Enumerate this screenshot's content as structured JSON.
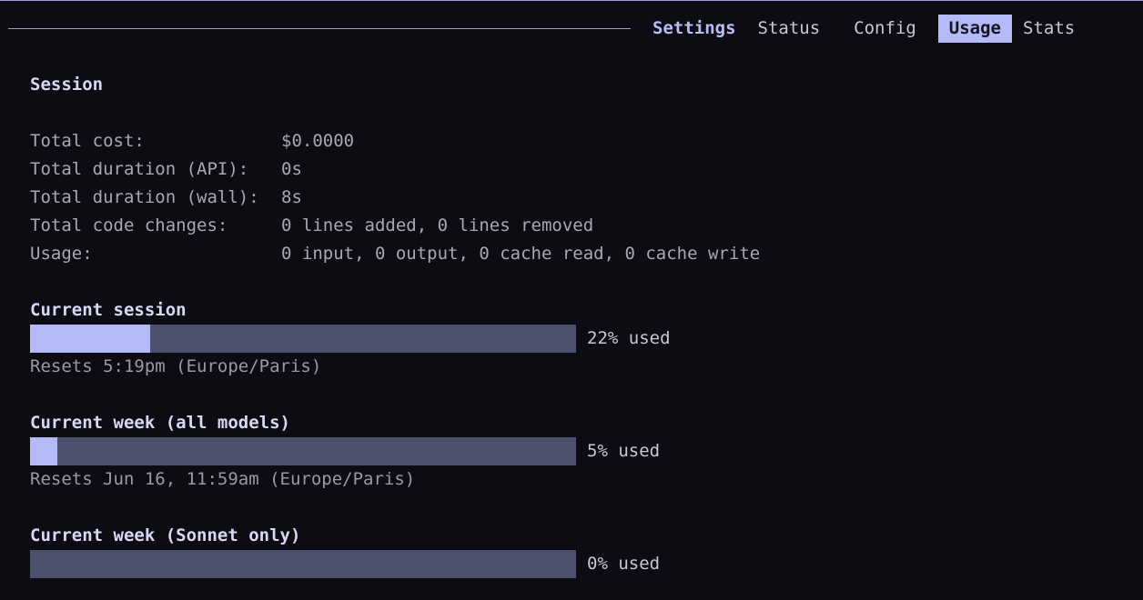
{
  "tabs": {
    "title": "Settings",
    "items": [
      "Status",
      "Config",
      "Usage",
      "Stats"
    ],
    "active": "Usage"
  },
  "session": {
    "heading": "Session",
    "stats": [
      {
        "label": "Total cost:",
        "value": "$0.0000"
      },
      {
        "label": "Total duration (API):",
        "value": "0s"
      },
      {
        "label": "Total duration (wall):",
        "value": "8s"
      },
      {
        "label": "Total code changes:",
        "value": "0 lines added, 0 lines removed"
      },
      {
        "label": "Usage:",
        "value": "0 input, 0 output, 0 cache read, 0 cache write"
      }
    ]
  },
  "limits": [
    {
      "title": "Current session",
      "percent": 22,
      "percent_text": "22% used",
      "reset": "Resets 5:19pm (Europe/Paris)"
    },
    {
      "title": "Current week (all models)",
      "percent": 5,
      "percent_text": "5% used",
      "reset": "Resets Jun 16, 11:59am (Europe/Paris)"
    },
    {
      "title": "Current week (Sonnet only)",
      "percent": 0,
      "percent_text": "0% used",
      "reset": ""
    }
  ],
  "colors": {
    "accent": "#b4b9f8",
    "bar_track": "#4d506c",
    "background": "#0c0c12"
  }
}
